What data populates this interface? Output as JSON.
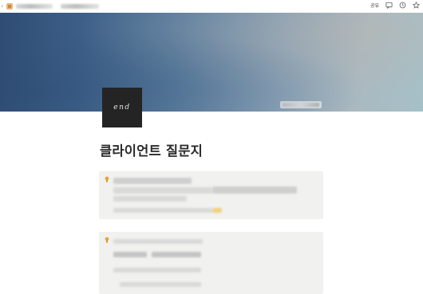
{
  "topbar": {
    "share_label": "공유",
    "icons": [
      "comment-icon",
      "clock-icon",
      "star-icon"
    ]
  },
  "cover": {
    "change_cover_label": ""
  },
  "page": {
    "icon_text": "end",
    "title": "클라이언트 질문지"
  },
  "colors": {
    "callout_bg": "#f1f1ef",
    "callout_icon": "#e3a83a",
    "icon_bg": "#242424"
  },
  "callouts": [
    {
      "icon": "lightbulb-icon"
    },
    {
      "icon": "lightbulb-icon"
    }
  ]
}
